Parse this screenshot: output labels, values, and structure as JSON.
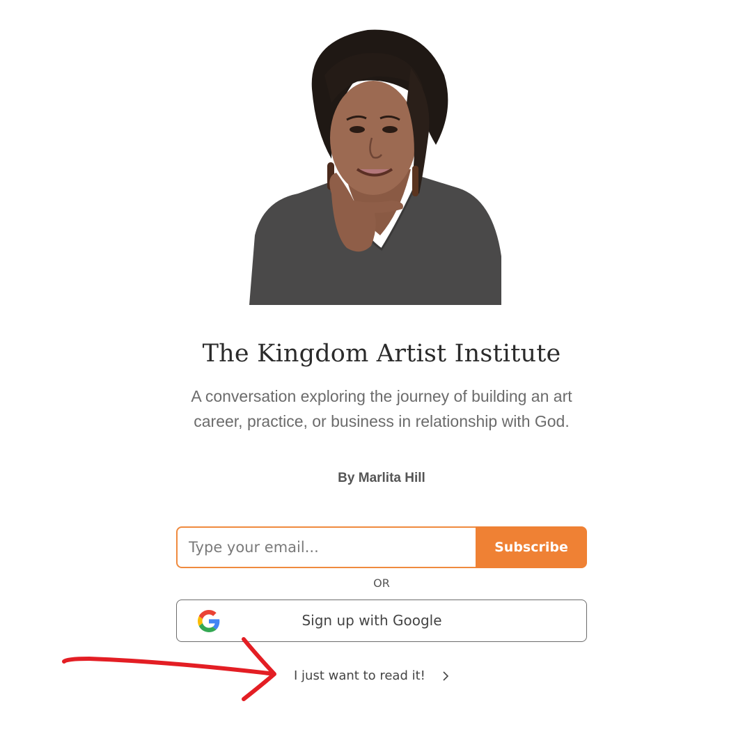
{
  "header": {
    "title": "The Kingdom Artist Institute",
    "description": "A conversation exploring the journey of building an art career, practice, or business in relationship with God.",
    "byline": "By Marlita Hill"
  },
  "subscribe_form": {
    "email_placeholder": "Type your email...",
    "email_value": "",
    "subscribe_label": "Subscribe"
  },
  "divider": {
    "or_label": "OR"
  },
  "google_signup": {
    "label": "Sign up with Google",
    "icon": "google-icon"
  },
  "read_link": {
    "label": "I just want to read it!",
    "icon": "chevron-right-icon"
  },
  "colors": {
    "accent": "#ef8134",
    "annotation_arrow": "#e31e24",
    "title_text": "#2b2b2b",
    "body_text": "#6b6b6b"
  }
}
